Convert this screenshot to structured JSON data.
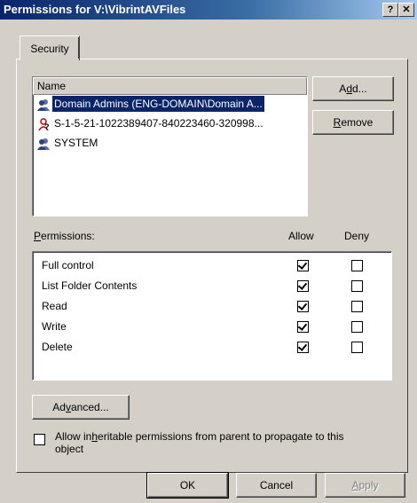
{
  "window": {
    "title": "Permissions for V:\\VibrintAVFiles",
    "help_btn": "?",
    "close_btn": "✕"
  },
  "tabs": [
    {
      "label": "Security"
    }
  ],
  "names_list": {
    "header": "Name",
    "items": [
      {
        "label": "Domain Admins (ENG-DOMAIN\\Domain A...",
        "icon": "user-group-icon",
        "selected": true
      },
      {
        "label": "S-1-5-21-1022389407-840223460-320998...",
        "icon": "unknown-user-icon",
        "selected": false
      },
      {
        "label": "SYSTEM",
        "icon": "user-group-icon",
        "selected": false
      }
    ]
  },
  "buttons": {
    "add": {
      "pre": "A",
      "mnemonic": "d",
      "post": "d..."
    },
    "remove": {
      "pre": "",
      "mnemonic": "R",
      "post": "emove"
    },
    "advanced": {
      "pre": "Ad",
      "mnemonic": "v",
      "post": "anced..."
    },
    "ok": "OK",
    "cancel": "Cancel",
    "apply": {
      "pre": "",
      "mnemonic": "A",
      "post": "pply"
    }
  },
  "permissions": {
    "label_mnemonic": "P",
    "label_rest": "ermissions:",
    "allow_header": "Allow",
    "deny_header": "Deny",
    "rows": [
      {
        "name": "Full control",
        "allow": true,
        "deny": false
      },
      {
        "name": "List Folder Contents",
        "allow": true,
        "deny": false
      },
      {
        "name": "Read",
        "allow": true,
        "deny": false
      },
      {
        "name": "Write",
        "allow": true,
        "deny": false
      },
      {
        "name": "Delete",
        "allow": true,
        "deny": false
      }
    ]
  },
  "inherit": {
    "line1_pre": "Allow in",
    "line1_mnemonic": "h",
    "line1_post": "eritable permissions from parent to propagate to this",
    "line2": "object",
    "checked": false
  }
}
